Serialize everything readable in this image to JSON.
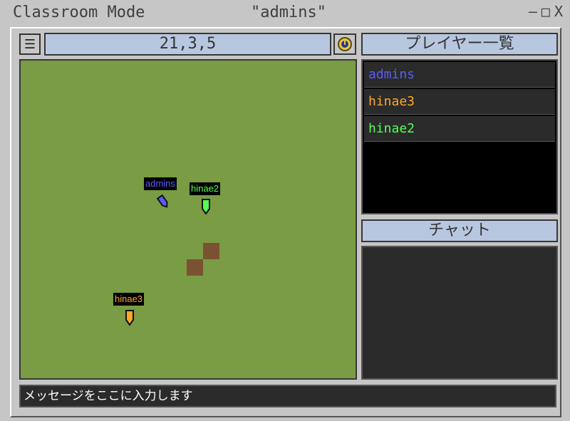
{
  "window": {
    "app_title": "Classroom Mode",
    "user_title": "\"admins\"",
    "minimize_label": "–",
    "maximize_label": "□",
    "close_label": "X"
  },
  "toolbar": {
    "menu_icon": "menu-icon",
    "coordinates": "21,3,5",
    "clock_icon": "clock-icon"
  },
  "player_panel": {
    "title": "プレイヤー一覧",
    "players": [
      {
        "name": "admins",
        "color": "#5b5bff"
      },
      {
        "name": "hinae3",
        "color": "#ffa726"
      },
      {
        "name": "hinae2",
        "color": "#55ff55"
      }
    ]
  },
  "chat_panel": {
    "title": "チャット"
  },
  "map": {
    "background": "#799c44",
    "players": [
      {
        "name": "admins",
        "color": "#5b5bff"
      },
      {
        "name": "hinae2",
        "color": "#55ff55"
      },
      {
        "name": "hinae3",
        "color": "#ffa726"
      }
    ]
  },
  "message_input": {
    "placeholder": "メッセージをここに入力します"
  }
}
